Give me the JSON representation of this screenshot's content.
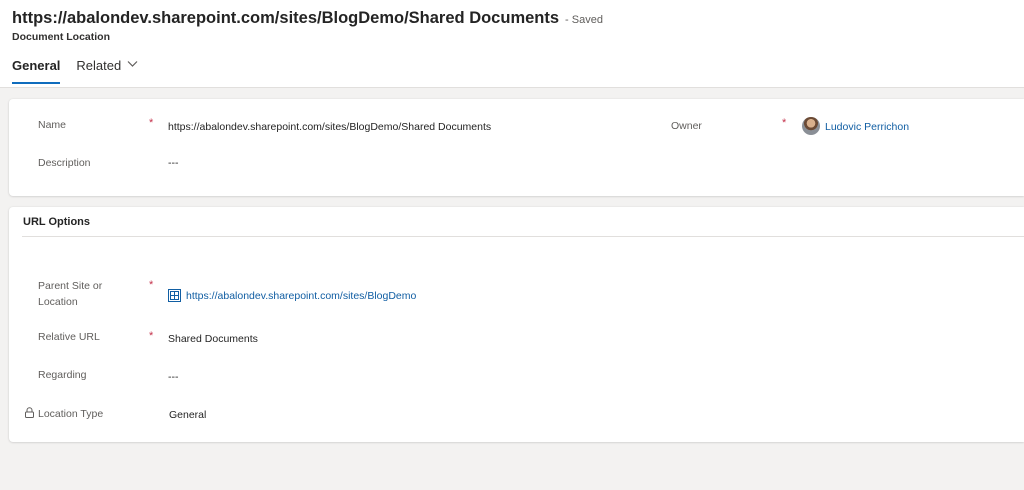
{
  "header": {
    "title": "https://abalondev.sharepoint.com/sites/BlogDemo/Shared Documents",
    "save_status": "- Saved",
    "entity_name": "Document Location",
    "tabs": [
      {
        "label": "General",
        "active": true
      },
      {
        "label": "Related",
        "active": false
      }
    ]
  },
  "general_section": {
    "name_label": "Name",
    "name_required": "*",
    "name_value": "https://abalondev.sharepoint.com/sites/BlogDemo/Shared Documents",
    "description_label": "Description",
    "description_value": "---",
    "owner_label": "Owner",
    "owner_required": "*",
    "owner_value": "Ludovic Perrichon"
  },
  "url_options": {
    "title": "URL Options",
    "parent_site_label_line1": "Parent Site or",
    "parent_site_label_line2": "Location",
    "parent_site_required": "*",
    "parent_site_value": "https://abalondev.sharepoint.com/sites/BlogDemo",
    "parent_site_icon": "sharepoint-site-icon",
    "relative_url_label": "Relative URL",
    "relative_url_required": "*",
    "relative_url_value": "Shared Documents",
    "regarding_label": "Regarding",
    "regarding_value": "---",
    "location_type_label": "Location Type",
    "location_type_icon": "lock-icon",
    "location_type_value": "General"
  },
  "colors": {
    "accent": "#0f6cbd",
    "link": "#115ea3",
    "required": "#c4314b",
    "background": "#f3f2f1"
  }
}
